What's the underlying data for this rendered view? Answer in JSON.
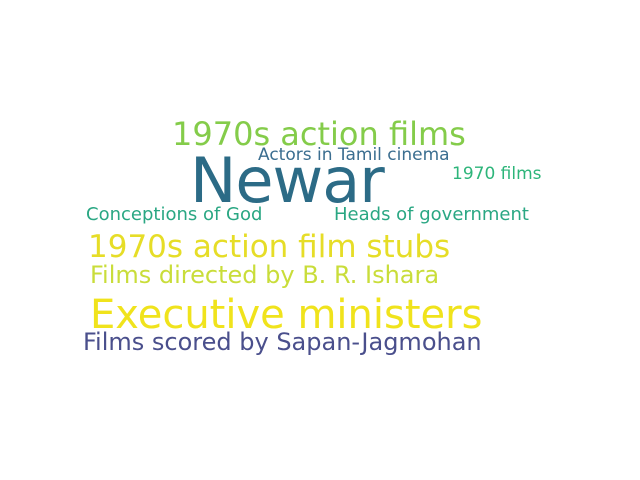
{
  "words": [
    {
      "text": "Newar",
      "color": "#2c6b86"
    },
    {
      "text": "1970s action films",
      "color": "#84cc4a"
    },
    {
      "text": "Actors in Tamil cinema",
      "color": "#3b6e90"
    },
    {
      "text": "1970 films",
      "color": "#2db57a"
    },
    {
      "text": "Conceptions of God",
      "color": "#2aa783"
    },
    {
      "text": "Heads of government",
      "color": "#2aa783"
    },
    {
      "text": "1970s action film stubs",
      "color": "#e6dd27"
    },
    {
      "text": "Films directed by B. R. Ishara",
      "color": "#c9dd3a"
    },
    {
      "text": "Executive ministers",
      "color": "#f0e31c"
    },
    {
      "text": "Films scored by Sapan-Jagmohan",
      "color": "#4a4f8c"
    }
  ]
}
